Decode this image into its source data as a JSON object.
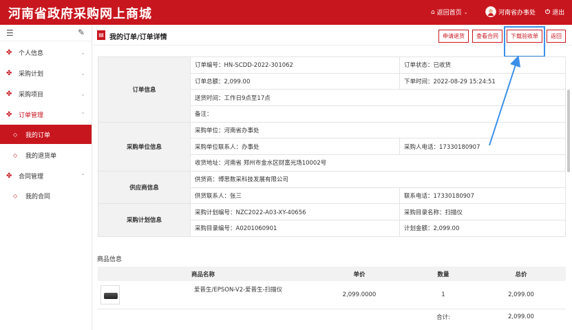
{
  "app": {
    "title": "河南省政府采购网上商城",
    "home_label": "返回首页",
    "user_name": "河南省办事处",
    "logout_label": "退出"
  },
  "sidebar": {
    "items": [
      {
        "label": "个人信息"
      },
      {
        "label": "采购计划"
      },
      {
        "label": "采购项目"
      },
      {
        "label": "订单管理"
      },
      {
        "label": "我的订单"
      },
      {
        "label": "我的退货单"
      },
      {
        "label": "合同管理"
      },
      {
        "label": "我的合同"
      }
    ]
  },
  "page": {
    "title": "我的订单/订单详情",
    "buttons": {
      "return_apply": "申请退货",
      "view_contract": "查看合同",
      "download_receipt": "下载验收单",
      "back": "返回"
    }
  },
  "order_info": {
    "section": "订单信息",
    "order_no": "订单编号：HN-SCDD-2022-301062",
    "status": "订单状态：已收货",
    "total": "订单总额：2,099.00",
    "order_time": "下单时间：2022-08-29 15:24:51",
    "delivery_time": "送货时间：工作日9点至17点",
    "remark": "备注："
  },
  "buyer_info": {
    "section": "采购单位信息",
    "unit": "采购单位：河南省办事处",
    "contact": "采购单位联系人：办事处",
    "phone": "采购人电话：17330180907",
    "address": "收货地址：河南省 郑州市金水区财富光场10002号"
  },
  "supplier_info": {
    "section": "供应商信息",
    "supplier": "供货商：博思数采科技发展有限公司",
    "contact": "供货联系人：张三",
    "phone": "联系电话：17330180907"
  },
  "plan_info": {
    "section": "采购计划信息",
    "plan_no": "采购计划编号：NZC2022-A03-XY-40656",
    "catalog_name": "采购目录名称：扫描仪",
    "catalog_no": "采购目录编号：A0201060901",
    "plan_amount": "计划金额：2,099.00"
  },
  "goods": {
    "title": "商品信息",
    "headers": {
      "name": "商品名称",
      "price": "单价",
      "qty": "数量",
      "total": "总价"
    },
    "rows": [
      {
        "name": "爱普生/EPSON-V2-爱普生-扫描仪",
        "price": "2,099.0000",
        "qty": "1",
        "total": "2,099.00"
      }
    ],
    "sum_label": "合计:",
    "sum_value": "2,099.00"
  },
  "colors": {
    "brand": "#c8161e",
    "annotation": "#3b8fe8"
  },
  "icons": [
    "home-icon",
    "chevron-down-icon",
    "power-icon",
    "menu-icon",
    "pin-icon",
    "grid-icon",
    "document-icon",
    "product-image"
  ]
}
